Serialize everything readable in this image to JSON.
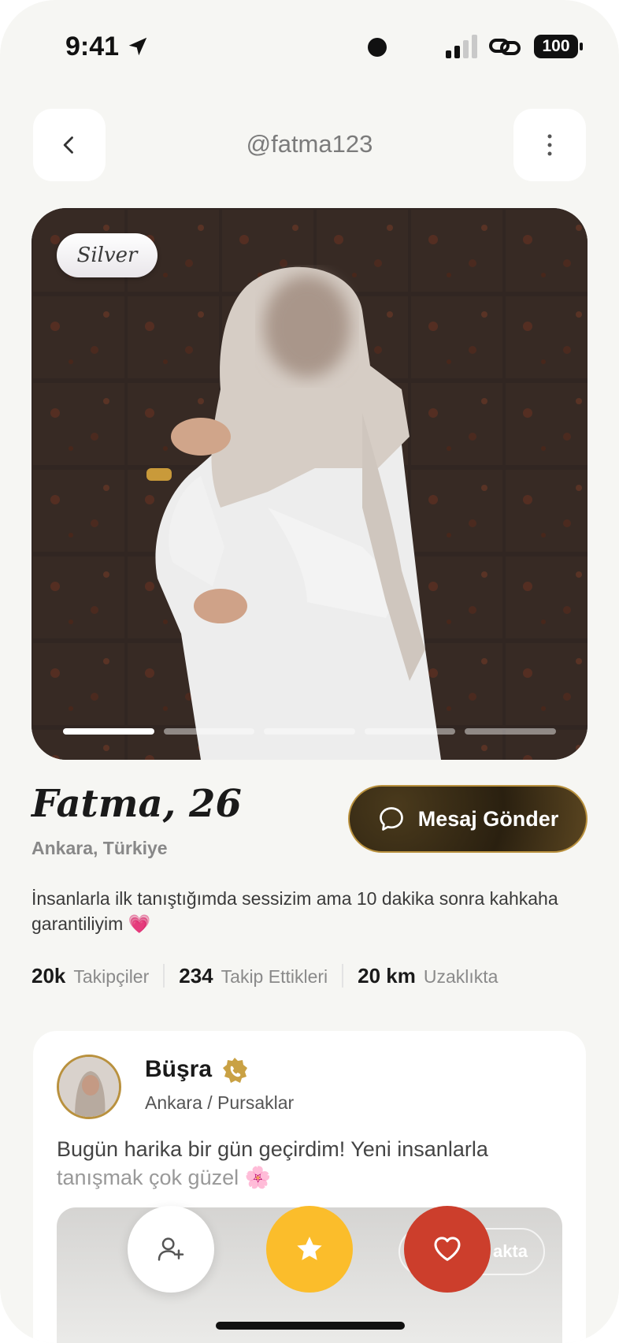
{
  "status_bar": {
    "time": "9:41",
    "battery": "100"
  },
  "header": {
    "username": "@fatma123"
  },
  "photo": {
    "tier_badge": "Silver",
    "page_count": 5,
    "active_page": 1
  },
  "profile": {
    "name_age": "Fatma, 26",
    "location": "Ankara, Türkiye",
    "message_button": "Mesaj Gönder",
    "bio": "İnsanlarla ilk tanıştığımda sessizim ama 10 dakika sonra kahkaha garantiliyim 💗",
    "stats": [
      {
        "value": "20k",
        "label": "Takipçiler"
      },
      {
        "value": "234",
        "label": "Takip Ettikleri"
      },
      {
        "value": "20 km",
        "label": "Uzaklıkta"
      }
    ]
  },
  "post": {
    "author": "Büşra",
    "location": "Ankara / Pursaklar",
    "text_main": "Bugün harika bir gün geçirdim! Yeni insanlarla",
    "text_fade": "tanışmak çok güzel 🌸",
    "image_badge": "akta"
  },
  "colors": {
    "background": "#f6f6f3",
    "gold_accent": "#b9913e",
    "star_button": "#fbbd2b",
    "heart_button": "#cc3e2c"
  },
  "icons": {
    "back": "chevron-left-icon",
    "more": "more-vertical-icon",
    "message": "chat-bubble-icon",
    "verified": "verified-badge-icon",
    "follow": "add-user-icon",
    "star": "star-icon",
    "heart": "heart-icon"
  }
}
